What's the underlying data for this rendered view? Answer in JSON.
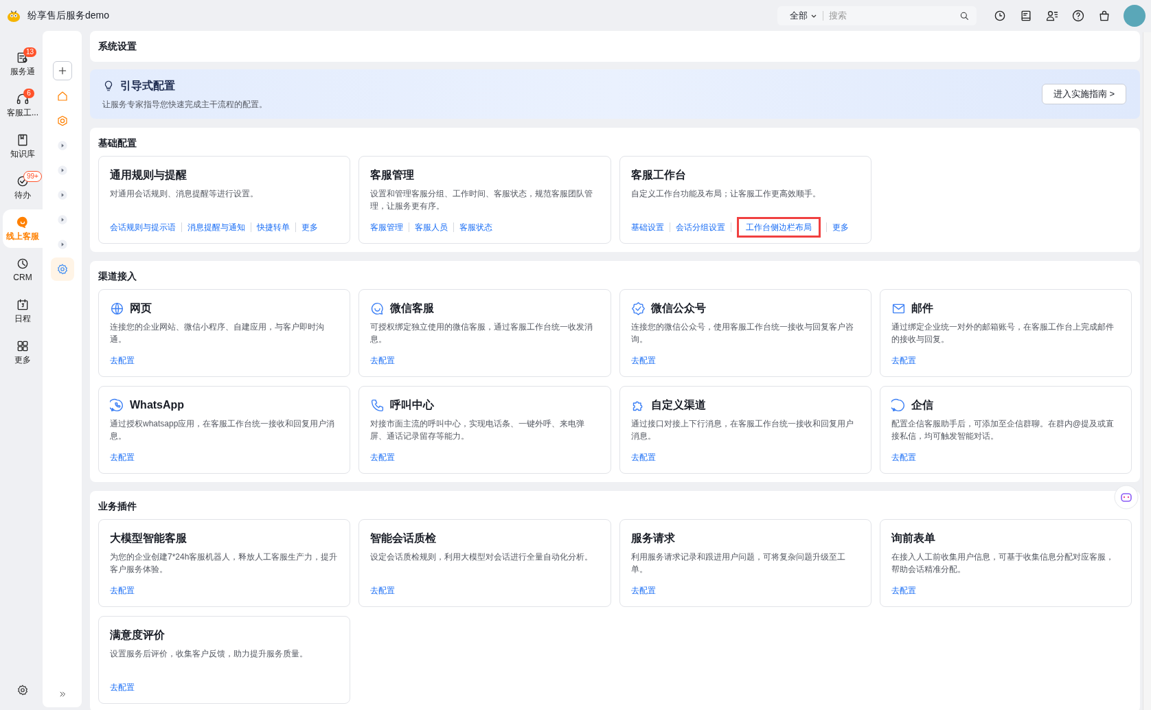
{
  "app": {
    "title": "纷享售后服务demo"
  },
  "search": {
    "scope": "全部",
    "placeholder": "搜索"
  },
  "nav": [
    {
      "label": "服务通",
      "badge": {
        "text": "13",
        "kind": "filled"
      },
      "selected": false
    },
    {
      "label": "客服工...",
      "badge": {
        "text": "6",
        "kind": "filled"
      },
      "selected": false
    },
    {
      "label": "知识库",
      "selected": false
    },
    {
      "label": "待办",
      "badge": {
        "text": "99+",
        "kind": "outline"
      },
      "selected": false
    },
    {
      "label": "线上客服",
      "selected": true
    },
    {
      "label": "CRM",
      "selected": false
    },
    {
      "label": "日程",
      "selected": false
    },
    {
      "label": "更多",
      "selected": false
    }
  ],
  "subnav": [
    {
      "kind": "home",
      "selected": false
    },
    {
      "kind": "hexagon",
      "selected": false
    },
    {
      "kind": "caret",
      "selected": false
    },
    {
      "kind": "caret",
      "selected": false
    },
    {
      "kind": "caret",
      "selected": false
    },
    {
      "kind": "caret",
      "selected": false
    },
    {
      "kind": "caret",
      "selected": false
    },
    {
      "kind": "gear",
      "selected": true
    }
  ],
  "page_title": "系统设置",
  "guide": {
    "title": "引导式配置",
    "subtitle": "让服务专家指导您快速完成主干流程的配置。",
    "button": "进入实施指南 >"
  },
  "sections": [
    {
      "title": "基础配置",
      "kind": "plain",
      "cards": [
        {
          "title": "通用规则与提醒",
          "description": "对通用会话规则、消息提醒等进行设置。",
          "links": [
            {
              "label": "会话规则与提示语",
              "highlighted": false
            },
            {
              "label": "消息提醒与通知",
              "highlighted": false
            },
            {
              "label": "快捷转单",
              "highlighted": false
            },
            {
              "label": "更多",
              "highlighted": false
            }
          ]
        },
        {
          "title": "客服管理",
          "description": "设置和管理客服分组、工作时间、客服状态，规范客服团队管理，让服务更有序。",
          "links": [
            {
              "label": "客服管理",
              "highlighted": false
            },
            {
              "label": "客服人员",
              "highlighted": false
            },
            {
              "label": "客服状态",
              "highlighted": false
            }
          ]
        },
        {
          "title": "客服工作台",
          "description": "自定义工作台功能及布局；让客服工作更高效顺手。",
          "links": [
            {
              "label": "基础设置",
              "highlighted": false
            },
            {
              "label": "会话分组设置",
              "highlighted": false
            },
            {
              "label": "工作台侧边栏布局",
              "highlighted": true
            },
            {
              "label": "更多",
              "highlighted": false
            }
          ]
        }
      ]
    },
    {
      "title": "渠道接入",
      "kind": "channels",
      "cards": [
        {
          "title": "网页",
          "description": "连接您的企业网站、微信小程序、自建应用，与客户即时沟通。",
          "links": [
            {
              "label": "去配置",
              "highlighted": false
            }
          ]
        },
        {
          "title": "微信客服",
          "description": "可授权绑定独立使用的微信客服，通过客服工作台统一收发消息。",
          "links": [
            {
              "label": "去配置",
              "highlighted": false
            }
          ]
        },
        {
          "title": "微信公众号",
          "description": "连接您的微信公众号，使用客服工作台统一接收与回复客户咨询。",
          "links": [
            {
              "label": "去配置",
              "highlighted": false
            }
          ]
        },
        {
          "title": "邮件",
          "description": "通过绑定企业统一对外的邮箱账号，在客服工作台上完成邮件的接收与回复。",
          "links": [
            {
              "label": "去配置",
              "highlighted": false
            }
          ]
        },
        {
          "title": "WhatsApp",
          "description": "通过授权whatsapp应用，在客服工作台统一接收和回复用户消息。",
          "links": [
            {
              "label": "去配置",
              "highlighted": false
            }
          ]
        },
        {
          "title": "呼叫中心",
          "description": "对接市面主流的呼叫中心，实现电话条、一键外呼、来电弹屏、通话记录留存等能力。",
          "links": [
            {
              "label": "去配置",
              "highlighted": false
            }
          ]
        },
        {
          "title": "自定义渠道",
          "description": "通过接口对接上下行消息，在客服工作台统一接收和回复用户消息。",
          "links": [
            {
              "label": "去配置",
              "highlighted": false
            }
          ]
        },
        {
          "title": "企信",
          "description": "配置企信客服助手后，可添加至企信群聊。在群内@提及或直接私信，均可触发智能对话。",
          "links": [
            {
              "label": "去配置",
              "highlighted": false
            }
          ]
        }
      ]
    },
    {
      "title": "业务插件",
      "kind": "plain",
      "cards": [
        {
          "title": "大模型智能客服",
          "description": "为您的企业创建7*24h客服机器人，释放人工客服生产力，提升客户服务体验。",
          "links": [
            {
              "label": "去配置",
              "highlighted": false
            }
          ]
        },
        {
          "title": "智能会话质检",
          "description": "设定会话质检规则，利用大模型对会话进行全量自动化分析。",
          "links": [
            {
              "label": "去配置",
              "highlighted": false
            }
          ]
        },
        {
          "title": "服务请求",
          "description": "利用服务请求记录和跟进用户问题，可将复杂问题升级至工单。",
          "links": [
            {
              "label": "去配置",
              "highlighted": false
            }
          ]
        },
        {
          "title": "询前表单",
          "description": "在接入人工前收集用户信息，可基于收集信息分配对应客服，帮助会话精准分配。",
          "links": [
            {
              "label": "去配置",
              "highlighted": false
            }
          ]
        },
        {
          "title": "满意度评价",
          "description": "设置服务后评价，收集客户反馈，助力提升服务质量。",
          "links": [
            {
              "label": "去配置",
              "highlighted": false
            }
          ]
        }
      ]
    }
  ]
}
